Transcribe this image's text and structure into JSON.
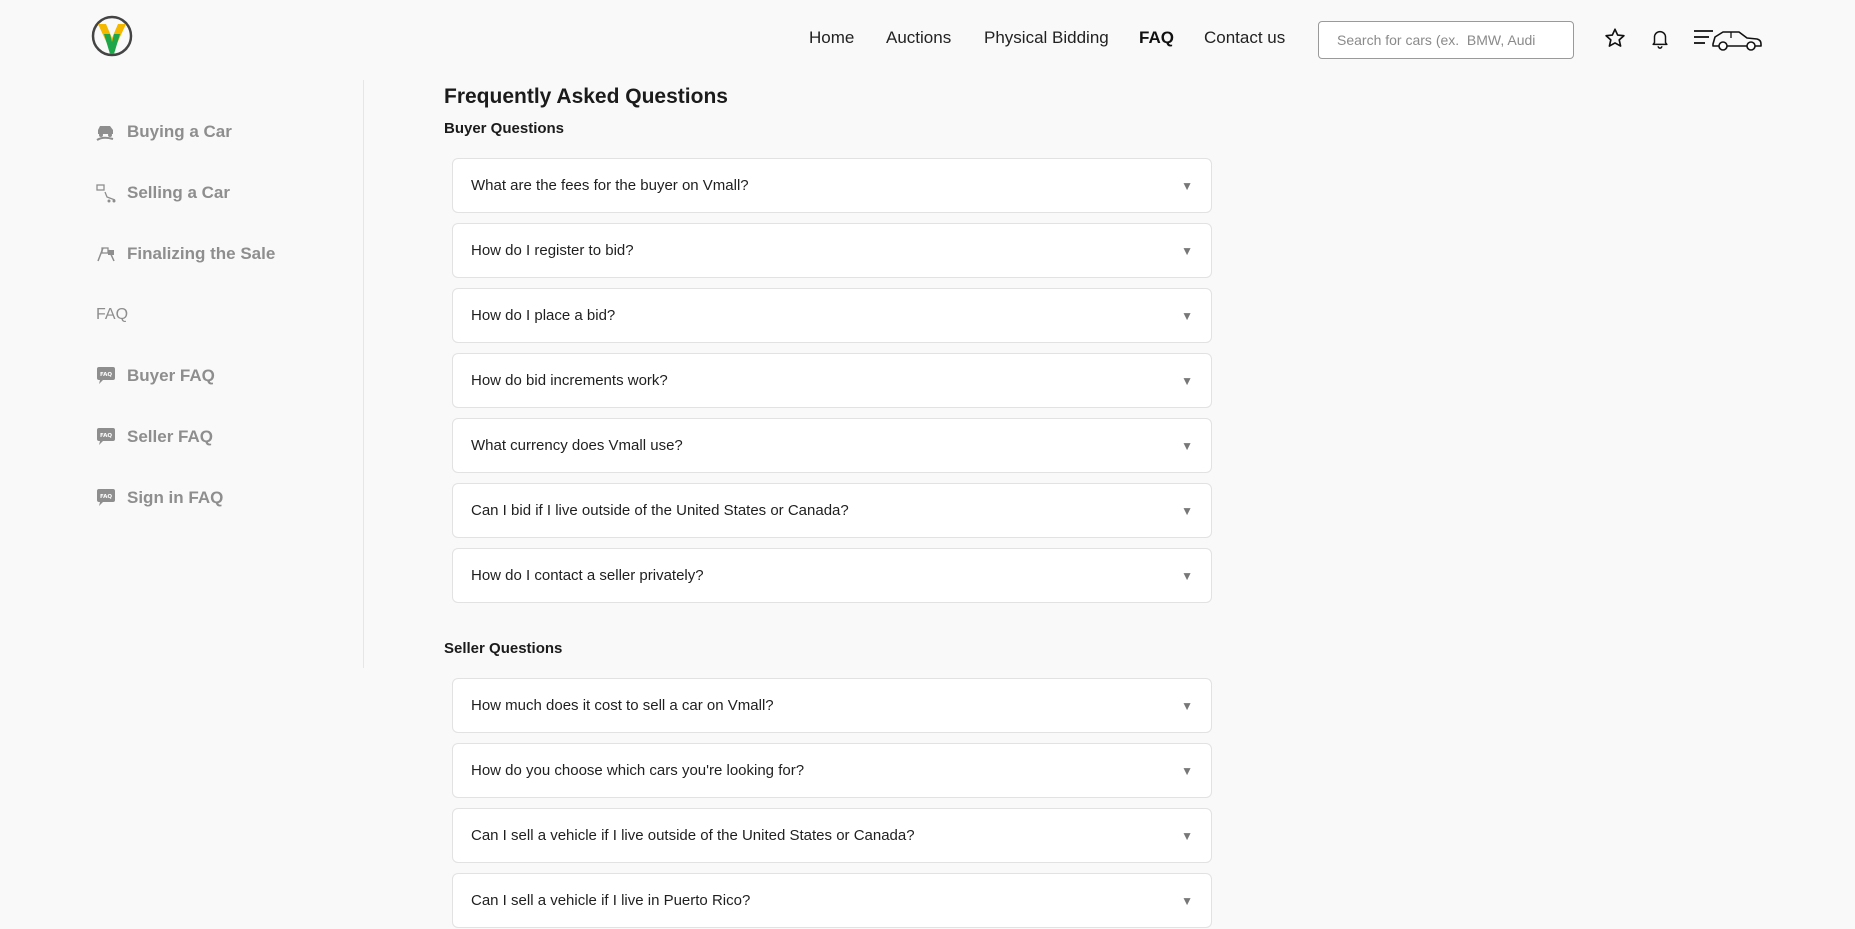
{
  "header": {
    "logo_icon": "vmall-logo-icon",
    "nav": [
      {
        "label": "Home",
        "active": false
      },
      {
        "label": "Auctions",
        "active": false
      },
      {
        "label": "Physical Bidding",
        "active": false
      },
      {
        "label": "FAQ",
        "active": true
      },
      {
        "label": "Contact us",
        "active": false
      }
    ],
    "search": {
      "placeholder": "Search for cars (ex.  BMW, Audi",
      "value": ""
    },
    "icons": [
      "star-icon",
      "bell-icon",
      "menu-car-icon"
    ]
  },
  "sidebar": {
    "items": [
      {
        "label": "Buying a Car",
        "icon": "buying-car-icon"
      },
      {
        "label": "Selling a Car",
        "icon": "selling-car-icon"
      },
      {
        "label": "Finalizing the Sale",
        "icon": "race-flags-icon"
      }
    ],
    "faq_heading": "FAQ",
    "faq_items": [
      {
        "label": "Buyer FAQ",
        "icon": "faq-bubble-icon"
      },
      {
        "label": "Seller FAQ",
        "icon": "faq-bubble-icon"
      },
      {
        "label": "Sign in FAQ",
        "icon": "faq-bubble-icon"
      }
    ]
  },
  "main": {
    "title": "Frequently Asked Questions",
    "sections": [
      {
        "title": "Buyer Questions",
        "questions": [
          "What are the fees for the buyer on Vmall?",
          "How do I register to bid?",
          "How do I place a bid?",
          "How do bid increments work?",
          "What currency does Vmall use?",
          "Can I bid if I live outside of the United States or Canada?",
          "How do I contact a seller privately?"
        ]
      },
      {
        "title": "Seller Questions",
        "questions": [
          "How much does it cost to sell a car on Vmall?",
          "How do you choose which cars you're looking for?",
          "Can I sell a vehicle if I live outside of the United States or Canada?",
          "Can I sell a vehicle if I live in Puerto Rico?"
        ]
      }
    ],
    "expand_glyph": "▼"
  },
  "colors": {
    "background": "#f9f9f9",
    "sidebar_text": "#8e8e8e",
    "logo_yellow": "#f5b800",
    "logo_green": "#1fa64a",
    "card_border": "#e2e2e2"
  }
}
